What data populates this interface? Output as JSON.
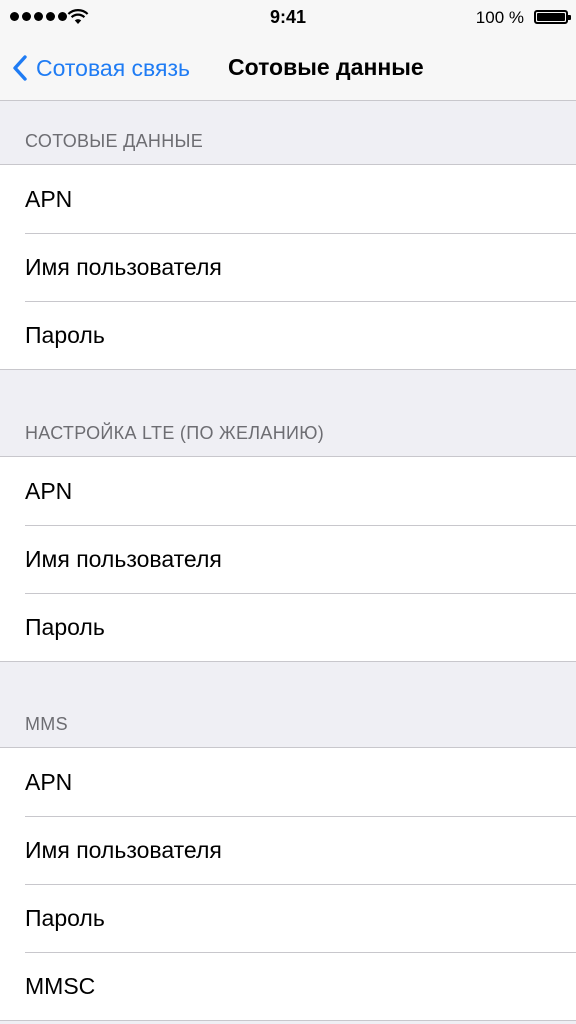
{
  "status_bar": {
    "time": "9:41",
    "battery": "100 %"
  },
  "nav": {
    "back_label": "Сотовая связь",
    "title": "Сотовые данные"
  },
  "sections": [
    {
      "header": "СОТОВЫЕ ДАННЫЕ",
      "rows": [
        "APN",
        "Имя пользователя",
        "Пароль"
      ]
    },
    {
      "header": "НАСТРОЙКА LTE (ПО ЖЕЛАНИЮ)",
      "rows": [
        "APN",
        "Имя пользователя",
        "Пароль"
      ]
    },
    {
      "header": "MMS",
      "rows": [
        "APN",
        "Имя пользователя",
        "Пароль",
        "MMSC"
      ]
    }
  ],
  "colors": {
    "accent": "#1f7cf4",
    "background": "#efeff4",
    "separator": "#c8c7cc",
    "section_header": "#6d6d72"
  },
  "icons": [
    "signal-strength-icon",
    "wifi-icon",
    "battery-icon",
    "chevron-left-icon"
  ]
}
